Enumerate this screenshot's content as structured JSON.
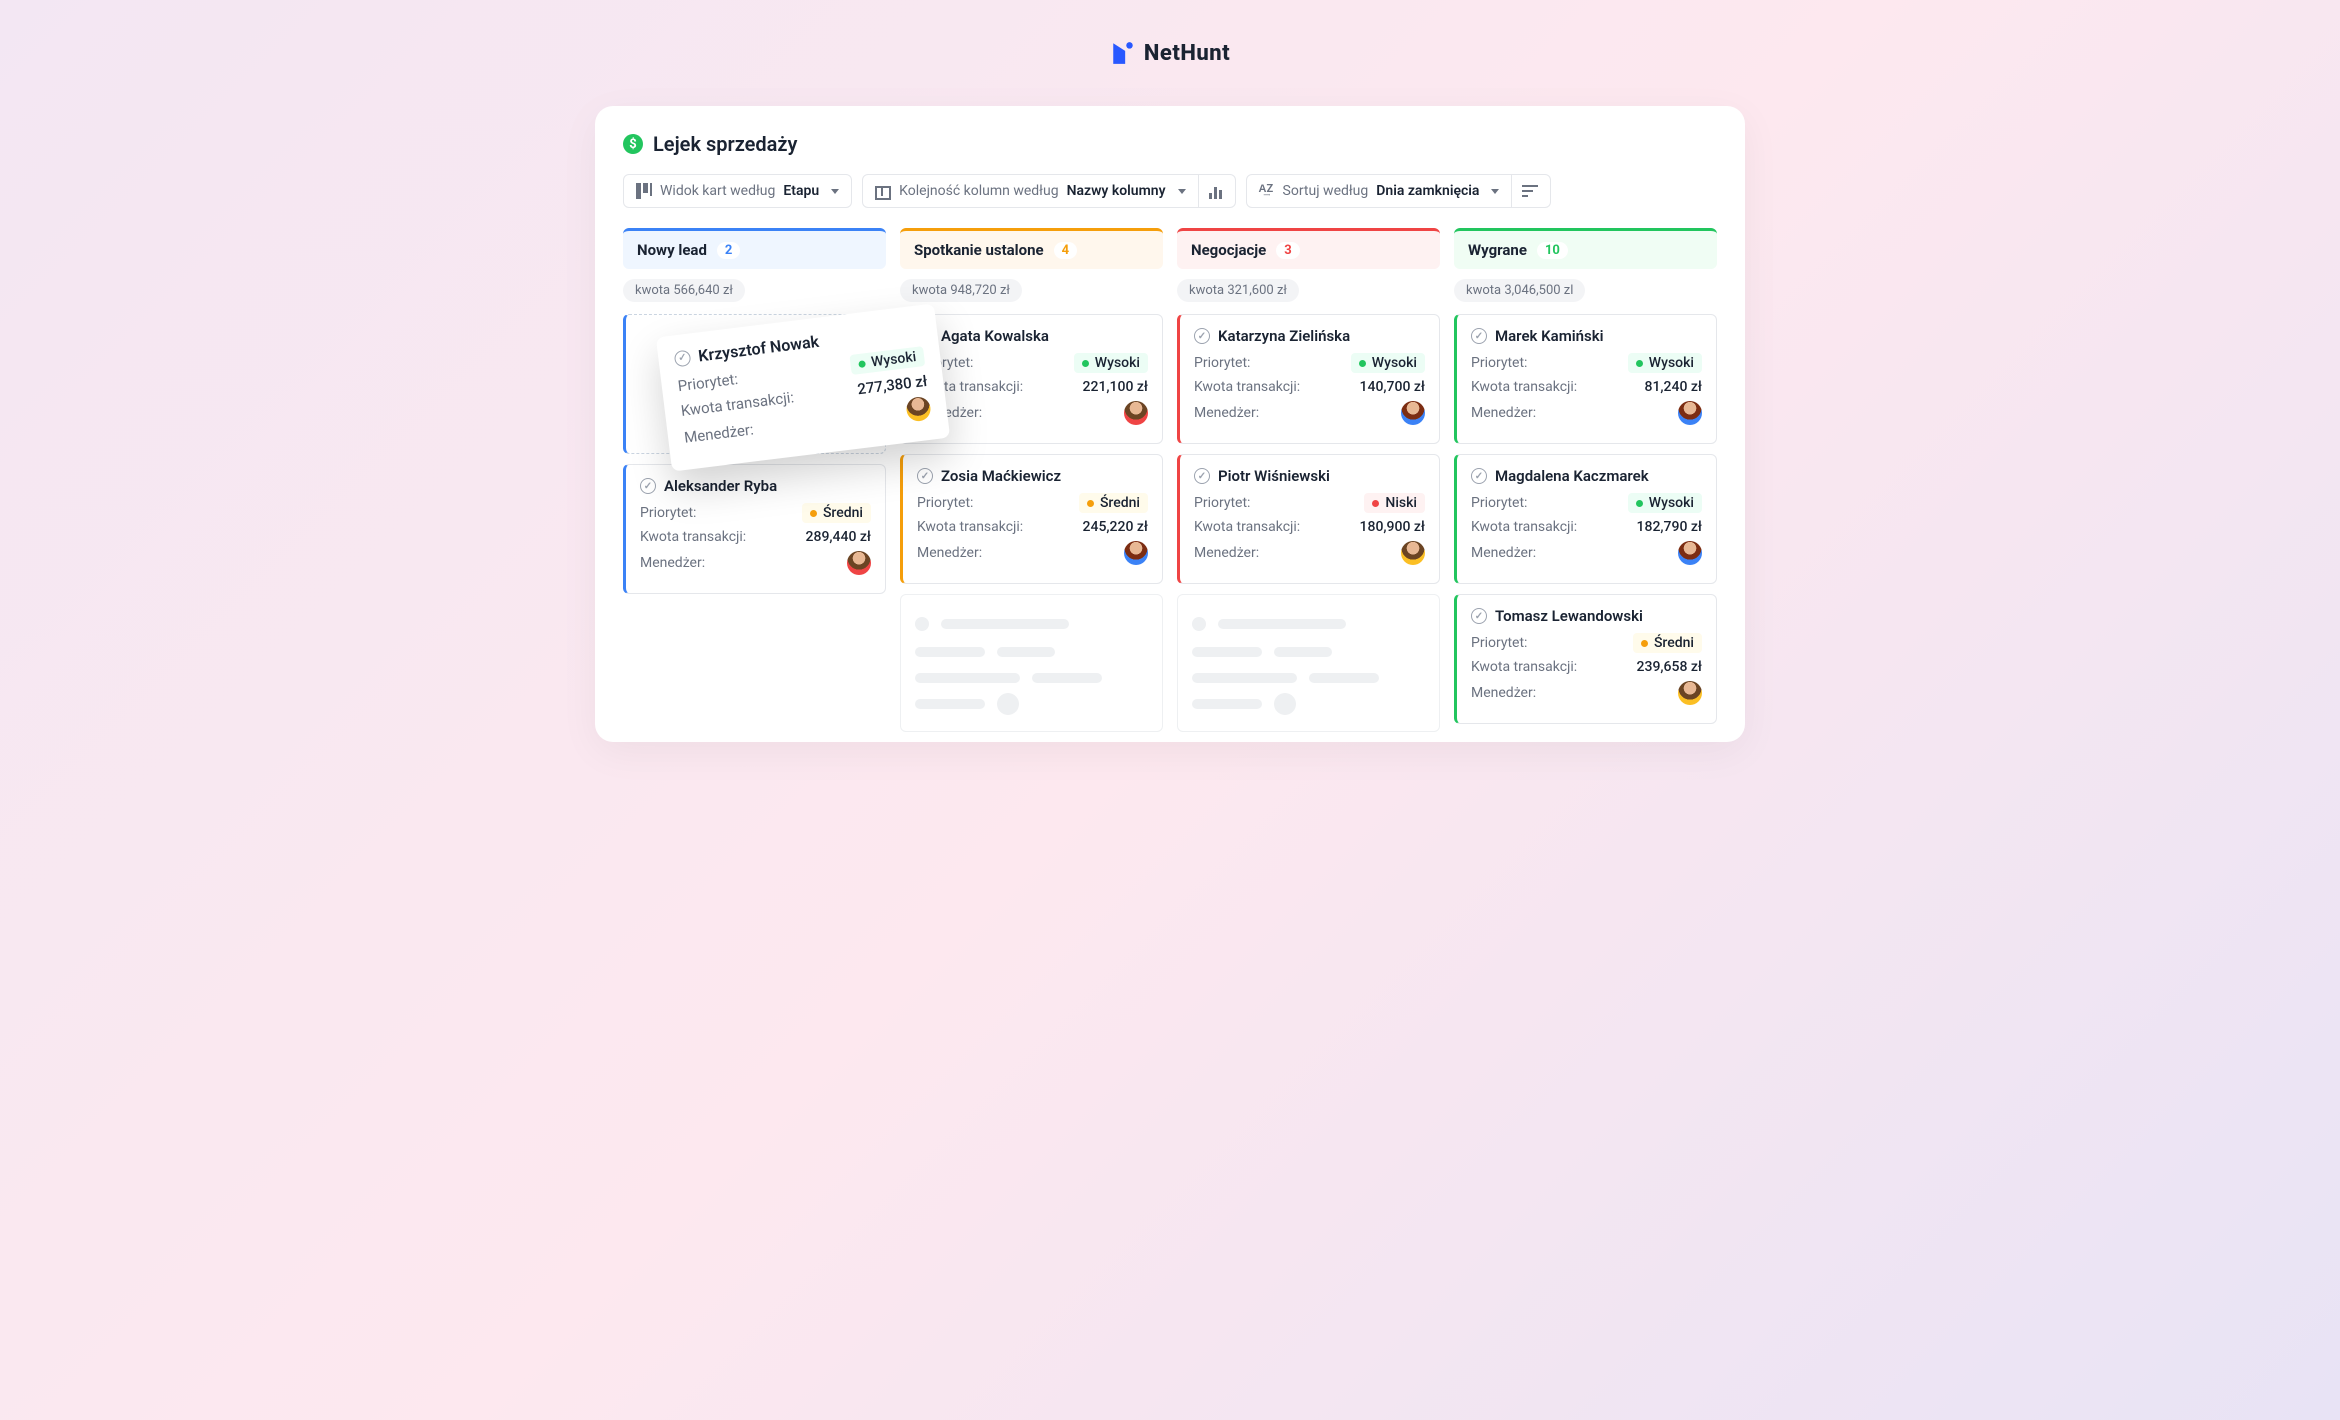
{
  "brand": {
    "name": "NetHunt"
  },
  "page": {
    "title": "Lejek sprzedaży"
  },
  "toolbar": {
    "view_label": "Widok kart według",
    "view_value": "Etapu",
    "order_label": "Kolejność kolumn według",
    "order_value": "Nazwy kolumny",
    "sort_label": "Sortuj według",
    "sort_value": "Dnia zamknięcia"
  },
  "labels": {
    "priority": "Priorytet:",
    "amount": "Kwota transakcji:",
    "manager": "Menedżer:",
    "amount_prefix": "kwota"
  },
  "priority": {
    "high": "Wysoki",
    "medium": "Średni",
    "low": "Niski"
  },
  "floating_card": {
    "name": "Krzysztof Nowak",
    "priority": "high",
    "amount": "277,380 zł",
    "avatar": "av1"
  },
  "columns": [
    {
      "id": "new",
      "title": "Nowy lead",
      "count": 2,
      "theme": "blue",
      "total": "566,640 zł",
      "placeholder": true,
      "cards": [
        {
          "name": "Aleksander Ryba",
          "priority": "medium",
          "amount": "289,440 zł",
          "avatar": "av3"
        }
      ],
      "skeletons": 0
    },
    {
      "id": "meeting",
      "title": "Spotkanie ustalone",
      "count": 4,
      "theme": "orange",
      "total": "948,720 zł",
      "placeholder": false,
      "cards": [
        {
          "name": "Agata Kowalska",
          "priority": "high",
          "amount": "221,100 zł",
          "avatar": "av3"
        },
        {
          "name": "Zosia Maćkiewicz",
          "priority": "medium",
          "amount": "245,220 zł",
          "avatar": "av2"
        }
      ],
      "skeletons": 1
    },
    {
      "id": "negotiation",
      "title": "Negocjacje",
      "count": 3,
      "theme": "red",
      "total": "321,600 zł",
      "placeholder": false,
      "cards": [
        {
          "name": "Katarzyna Zielińska",
          "priority": "high",
          "amount": "140,700 zł",
          "avatar": "av2"
        },
        {
          "name": "Piotr Wiśniewski",
          "priority": "low",
          "amount": "180,900 zł",
          "avatar": "av1"
        }
      ],
      "skeletons": 1
    },
    {
      "id": "won",
      "title": "Wygrane",
      "count": 10,
      "theme": "green",
      "total": "3,046,500 zl",
      "placeholder": false,
      "cards": [
        {
          "name": "Marek Kamiński",
          "priority": "high",
          "amount": "81,240 zł",
          "avatar": "av2"
        },
        {
          "name": "Magdalena Kaczmarek",
          "priority": "high",
          "amount": "182,790 zł",
          "avatar": "av2"
        },
        {
          "name": "Tomasz Lewandowski",
          "priority": "medium",
          "amount": "239,658 zł",
          "avatar": "av1"
        }
      ],
      "skeletons": 0
    }
  ]
}
